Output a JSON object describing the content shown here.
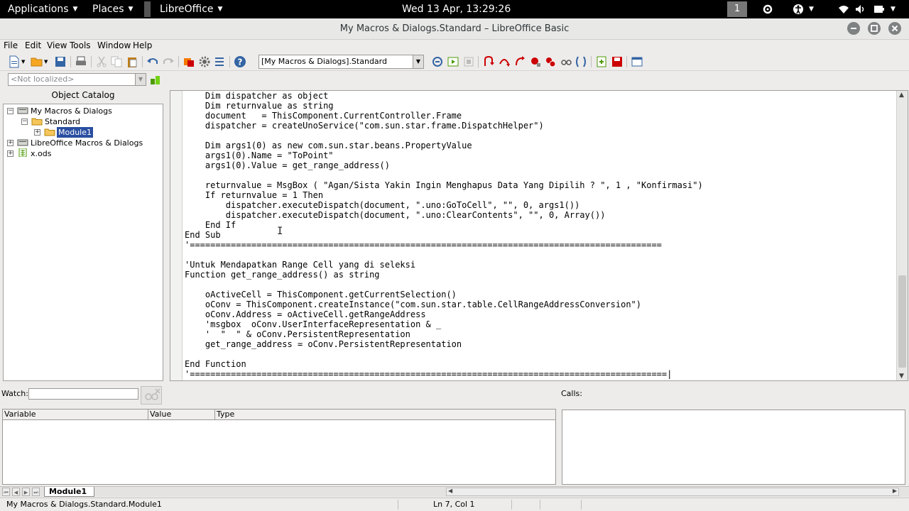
{
  "top_panel": {
    "applications": "Applications",
    "places": "Places",
    "app_name": "LibreOffice",
    "clock": "Wed 13 Apr, 13:29:26",
    "workspace": "1"
  },
  "window": {
    "title": "My Macros & Dialogs.Standard – LibreOffice Basic"
  },
  "menu": [
    "File",
    "Edit",
    "View",
    "Tools",
    "Window",
    "Help"
  ],
  "toolbar": {
    "library_select": "[My Macros & Dialogs].Standard",
    "language_select": "<Not localized>"
  },
  "catalog": {
    "title": "Object Catalog",
    "tree": [
      {
        "label": "My Macros & Dialogs",
        "expander": "−",
        "icon": "macros-container-icon"
      },
      {
        "label": "Standard",
        "expander": "−",
        "icon": "folder-icon"
      },
      {
        "label": "Module1",
        "expander": "+",
        "icon": "folder-icon"
      },
      {
        "label": "LibreOffice Macros & Dialogs",
        "expander": "+",
        "icon": "macros-container-icon"
      },
      {
        "label": "x.ods",
        "expander": "+",
        "icon": "spreadsheet-icon"
      }
    ]
  },
  "editor": {
    "lines": [
      "    Dim dispatcher as object",
      "    Dim returnvalue as string",
      "    document   = ThisComponent.CurrentController.Frame",
      "    dispatcher = createUnoService(\"com.sun.star.frame.DispatchHelper\")",
      "",
      "    Dim args1(0) as new com.sun.star.beans.PropertyValue",
      "    args1(0).Name = \"ToPoint\"",
      "    args1(0).Value = get_range_address()",
      "",
      "    returnvalue = MsgBox ( \"Agan/Sista Yakin Ingin Menghapus Data Yang Dipilih ? \", 1 , \"Konfirmasi\")",
      "    If returnvalue = 1 Then",
      "        dispatcher.executeDispatch(document, \".uno:GoToCell\", \"\", 0, args1())",
      "        dispatcher.executeDispatch(document, \".uno:ClearContents\", \"\", 0, Array())",
      "    End If",
      "End Sub",
      "'============================================================================================",
      "",
      "'Untuk Mendapatkan Range Cell yang di seleksi",
      "Function get_range_address() as string",
      "",
      "    oActiveCell = ThisComponent.getCurrentSelection()",
      "    oConv = ThisComponent.createInstance(\"com.sun.star.table.CellRangeAddressConversion\")",
      "    oConv.Address = oActiveCell.getRangeAddress",
      "    'msgbox  oConv.UserInterfaceRepresentation & _",
      "    '  \"  \" & oConv.PersistentRepresentation",
      "    get_range_address = oConv.PersistentRepresentation",
      "",
      "End Function",
      "'=============================================================================================|"
    ]
  },
  "watch": {
    "label": "Watch:",
    "value": "",
    "columns": [
      "Variable",
      "Value",
      "Type"
    ]
  },
  "calls": {
    "label": "Calls:"
  },
  "tabs": {
    "module_tab": "Module1"
  },
  "status": {
    "location": "My Macros & Dialogs.Standard.Module1",
    "cursor": "Ln 7, Col 1"
  }
}
